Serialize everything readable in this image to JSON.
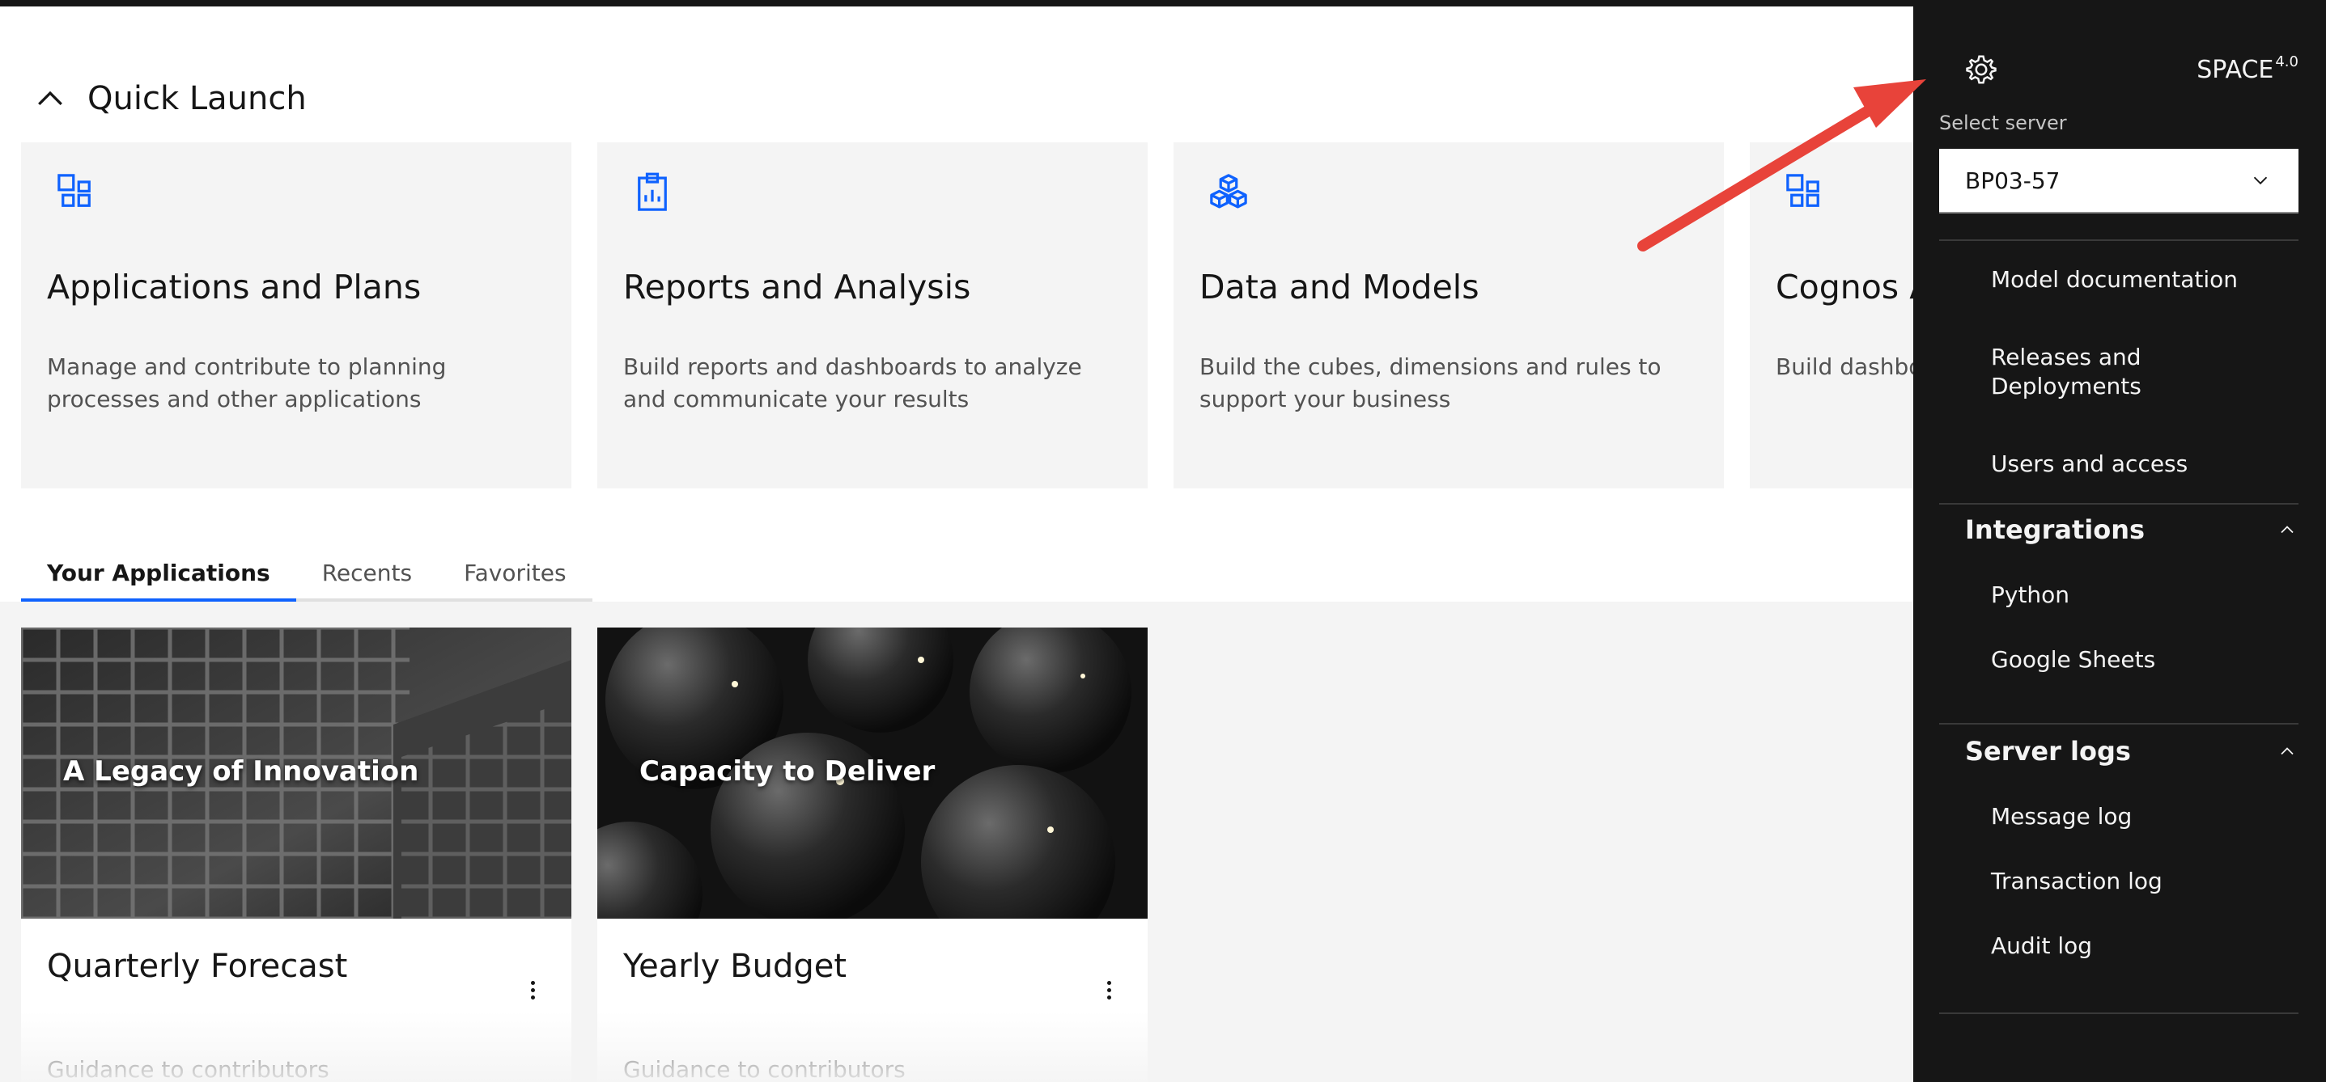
{
  "quick_launch": {
    "title": "Quick Launch",
    "cards": [
      {
        "title": "Applications and Plans",
        "description": "Manage and contribute to planning processes and other applications",
        "icon": "applications-icon"
      },
      {
        "title": "Reports and Analysis",
        "description": "Build reports and dashboards to analyze and communicate your results",
        "icon": "report-clipboard-icon"
      },
      {
        "title": "Data and Models",
        "description": "Build the cubes, dimensions and rules to support your business",
        "icon": "cubes-icon"
      },
      {
        "title": "Cognos Analytics",
        "description": "Build dashboards",
        "icon": "applications-icon"
      }
    ]
  },
  "tabs": [
    "Your Applications",
    "Recents",
    "Favorites"
  ],
  "active_tab": "Your Applications",
  "applications": [
    {
      "image_label": "A Legacy of Innovation",
      "name": "Quarterly Forecast",
      "guidance": "Guidance to contributors"
    },
    {
      "image_label": "Capacity to Deliver",
      "name": "Yearly Budget",
      "guidance": "Guidance to contributors"
    }
  ],
  "panel": {
    "brand": "SPACE",
    "version": "4.0",
    "select_label": "Select server",
    "server": "BP03-57",
    "items_top": [
      "Model documentation",
      "Releases and Deployments",
      "Users and access"
    ],
    "integrations": {
      "title": "Integrations",
      "items": [
        "Python",
        "Google Sheets"
      ]
    },
    "server_logs": {
      "title": "Server logs",
      "items": [
        "Message log",
        "Transaction log",
        "Audit log"
      ]
    }
  },
  "colors": {
    "accent": "#0f62fe",
    "panel_bg": "#161616",
    "card_bg": "#f4f4f4",
    "annotation": "#e8433a"
  }
}
